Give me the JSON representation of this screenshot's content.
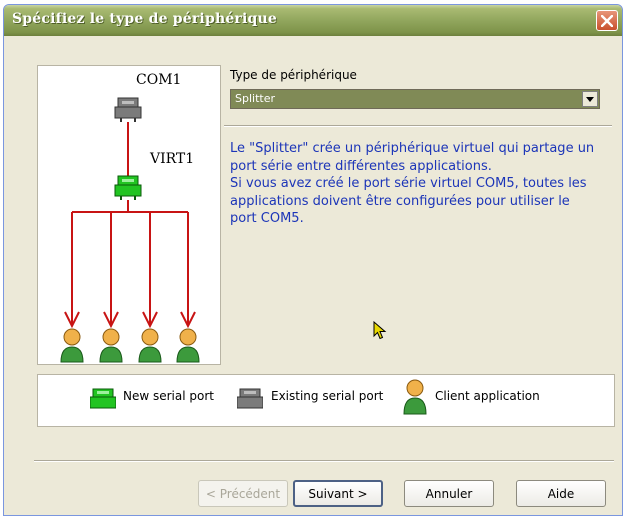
{
  "window": {
    "title": "Spécifiez le type de périphérique"
  },
  "diagram": {
    "com_label": "COM1",
    "virt_label": "VIRT1"
  },
  "field": {
    "label": "Type de périphérique",
    "value": "Splitter"
  },
  "description": [
    "Le \"Splitter\" crée un périphérique virtuel qui partage un port série entre différentes applications.",
    "Si vous avez créé le port série virtuel COM5, toutes les applications doivent être configurées pour utiliser le port COM5."
  ],
  "legend": {
    "new_port": "New serial port",
    "existing_port": "Existing serial port",
    "client_app": "Client application"
  },
  "buttons": {
    "back": "< Précédent",
    "next": "Suivant >",
    "cancel": "Annuler",
    "help": "Aide"
  },
  "colors": {
    "accent_text": "#1c35b8",
    "new_port": "#22c422",
    "existing_port": "#7b7b7b",
    "arrow": "#c81414"
  }
}
